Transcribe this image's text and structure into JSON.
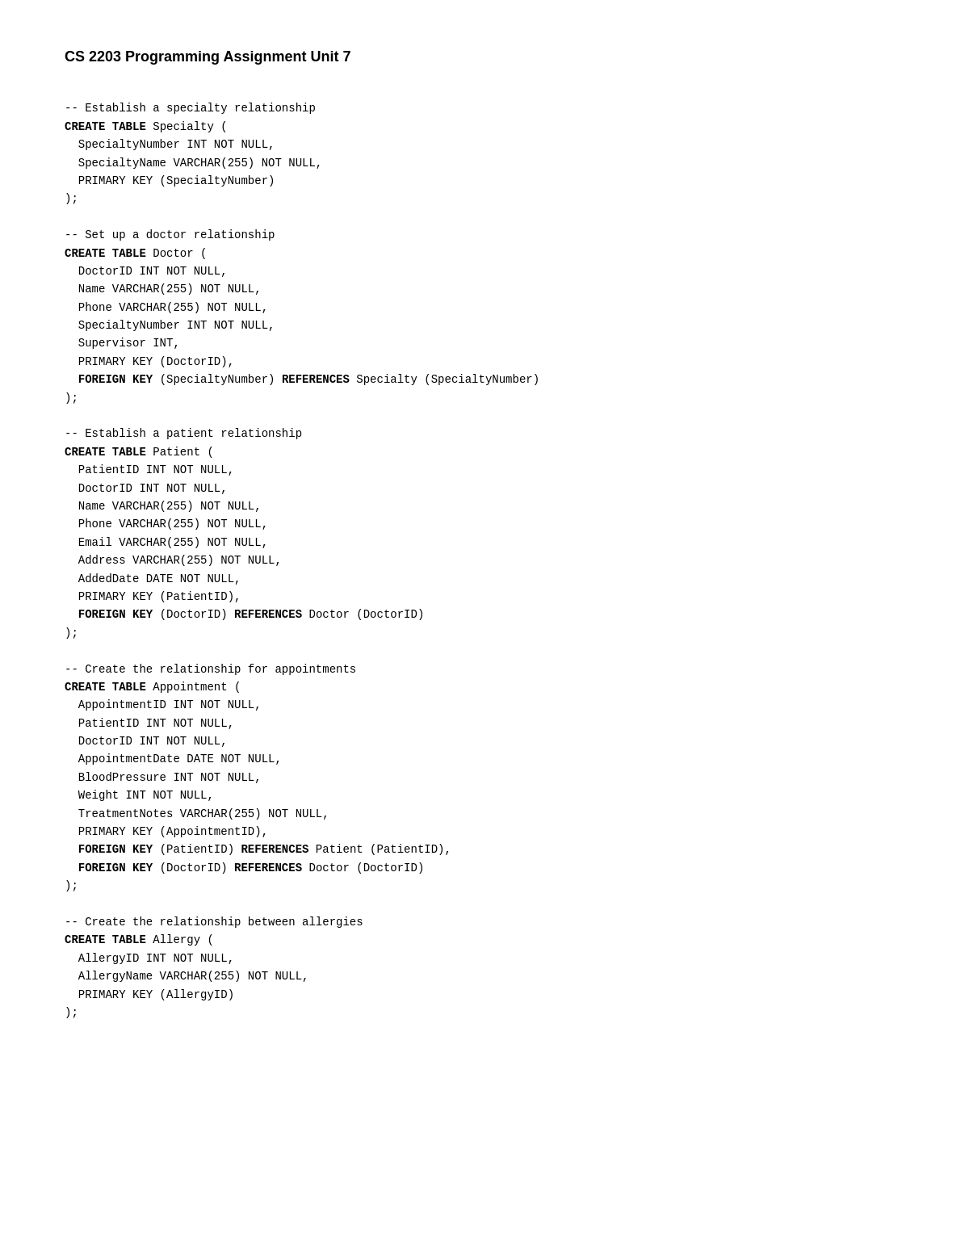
{
  "page": {
    "title": "CS 2203 Programming Assignment Unit 7"
  },
  "code": {
    "specialty_comment": "-- Establish a specialty relationship",
    "specialty_create": "CREATE TABLE Specialty (",
    "specialty_body": "  SpecialtyNumber INT NOT NULL,\n  SpecialtyName VARCHAR(255) NOT NULL,\n  PRIMARY KEY (SpecialtyNumber)\n);",
    "doctor_comment": "-- Set up a doctor relationship",
    "doctor_create": "CREATE TABLE Doctor (",
    "doctor_body": "  DoctorID INT NOT NULL,\n  Name VARCHAR(255) NOT NULL,\n  Phone VARCHAR(255) NOT NULL,\n  SpecialtyNumber INT NOT NULL,\n  Supervisor INT,\n  PRIMARY KEY (DoctorID),\n  FOREIGN KEY (SpecialtyNumber) REFERENCES Specialty (SpecialtyNumber)\n);",
    "patient_comment": "-- Establish a patient relationship",
    "patient_create": "CREATE TABLE Patient (",
    "patient_body": "  PatientID INT NOT NULL,\n  DoctorID INT NOT NULL,\n  Name VARCHAR(255) NOT NULL,\n  Phone VARCHAR(255) NOT NULL,\n  Email VARCHAR(255) NOT NULL,\n  Address VARCHAR(255) NOT NULL,\n  AddedDate DATE NOT NULL,\n  PRIMARY KEY (PatientID),\n  FOREIGN KEY (DoctorID) REFERENCES Doctor (DoctorID)\n);",
    "appointment_comment": "-- Create the relationship for appointments",
    "appointment_create": "CREATE TABLE Appointment (",
    "appointment_body": "  AppointmentID INT NOT NULL,\n  PatientID INT NOT NULL,\n  DoctorID INT NOT NULL,\n  AppointmentDate DATE NOT NULL,\n  BloodPressure INT NOT NULL,\n  Weight INT NOT NULL,\n  TreatmentNotes VARCHAR(255) NOT NULL,\n  PRIMARY KEY (AppointmentID),\n  FOREIGN KEY (PatientID) REFERENCES Patient (PatientID),\n  FOREIGN KEY (DoctorID) REFERENCES Doctor (DoctorID)\n);",
    "allergy_comment": "-- Create the relationship between allergies",
    "allergy_create": "CREATE TABLE Allergy (",
    "allergy_body": "  AllergyID INT NOT NULL,\n  AllergyName VARCHAR(255) NOT NULL,\n  PRIMARY KEY (AllergyID)\n);"
  }
}
